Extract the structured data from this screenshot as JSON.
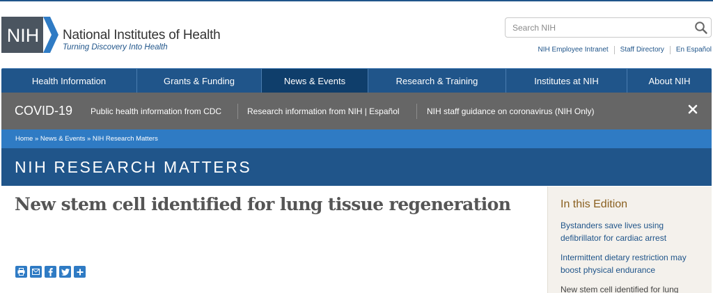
{
  "header": {
    "logo_mark": "NIH",
    "title": "National Institutes of Health",
    "tagline": "Turning Discovery Into Health",
    "search_placeholder": "Search NIH",
    "util_links": [
      "NIH Employee Intranet",
      "Staff Directory",
      "En Español"
    ]
  },
  "nav": {
    "items": [
      "Health Information",
      "Grants & Funding",
      "News & Events",
      "Research & Training",
      "Institutes at NIH",
      "About NIH"
    ],
    "active": "News & Events"
  },
  "covid": {
    "title": "COVID-19",
    "links": [
      "Public health information from CDC",
      "Research information from NIH | Español",
      "NIH staff guidance on coronavirus (NIH Only)"
    ]
  },
  "breadcrumb": "Home » News & Events » NIH Research Matters",
  "section_title": "NIH RESEARCH MATTERS",
  "article": {
    "headline": "New stem cell identified for lung tissue regeneration",
    "share_icons": [
      "print-icon",
      "email-icon",
      "facebook-icon",
      "twitter-icon",
      "plus-icon"
    ]
  },
  "sidebar": {
    "title": "In this Edition",
    "items": [
      {
        "l1": "Bystanders save lives using",
        "l2": "defibrillator for cardiac arrest"
      },
      {
        "l1": "Intermittent dietary restriction may",
        "l2": "boost physical endurance"
      },
      {
        "l1": "New stem cell identified for lung"
      }
    ]
  },
  "colors": {
    "nih_blue": "#20558a",
    "nav_active": "#0f3e6b",
    "breadcrumb_blue": "#2f7bc4",
    "covid_gray": "#666666",
    "sidebar_title": "#8a6020"
  }
}
